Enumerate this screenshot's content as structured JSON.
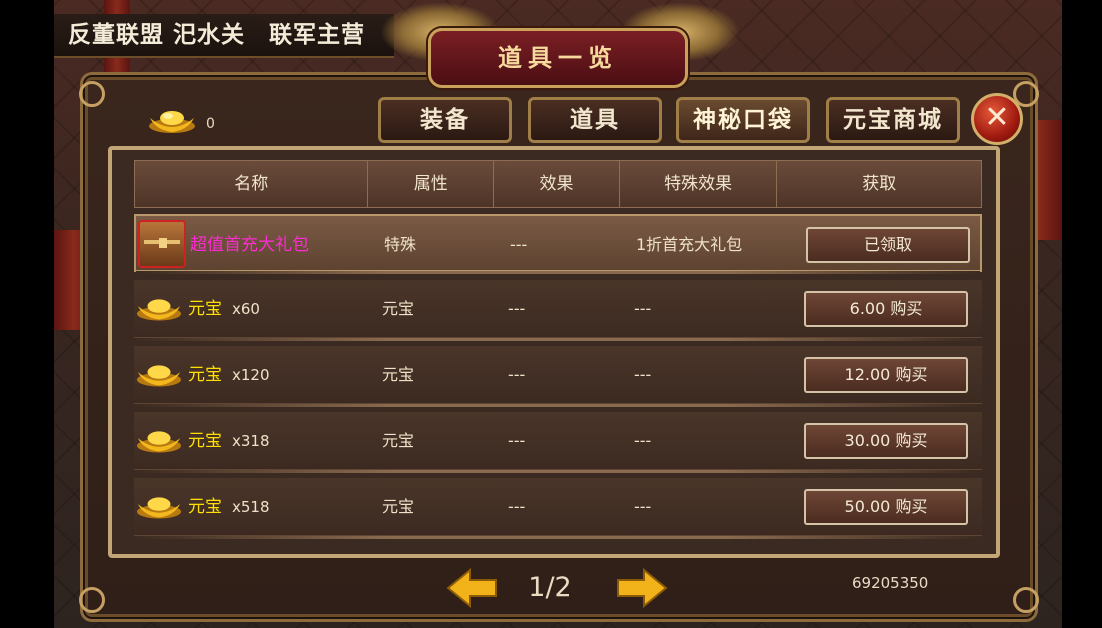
{
  "location": "反董联盟 汜水关　联军主营",
  "title": "道具一览",
  "currency": {
    "icon": "gold-ingot-icon",
    "value": "0"
  },
  "tabs": [
    {
      "label": "装备",
      "active": false
    },
    {
      "label": "道具",
      "active": false
    },
    {
      "label": "神秘口袋",
      "active": true
    },
    {
      "label": "元宝商城",
      "active": false
    }
  ],
  "close_label": "✕",
  "table": {
    "headers": [
      "名称",
      "属性",
      "效果",
      "特殊效果",
      "获取"
    ],
    "rows": [
      {
        "icon": "treasure-chest-icon",
        "name": "超值首充大礼包",
        "qty": "",
        "attr": "特殊",
        "effect": "---",
        "special": "1折首充大礼包",
        "action": "已领取"
      },
      {
        "icon": "gold-ingot-icon",
        "name": "元宝",
        "qty": "x60",
        "attr": "元宝",
        "effect": "---",
        "special": "---",
        "action": "6.00 购买"
      },
      {
        "icon": "gold-ingot-icon",
        "name": "元宝",
        "qty": "x120",
        "attr": "元宝",
        "effect": "---",
        "special": "---",
        "action": "12.00 购买"
      },
      {
        "icon": "gold-ingot-icon",
        "name": "元宝",
        "qty": "x318",
        "attr": "元宝",
        "effect": "---",
        "special": "---",
        "action": "30.00 购买"
      },
      {
        "icon": "gold-ingot-icon",
        "name": "元宝",
        "qty": "x518",
        "attr": "元宝",
        "effect": "---",
        "special": "---",
        "action": "50.00 购买"
      }
    ]
  },
  "pager": {
    "page": "1/2",
    "prev_icon": "arrow-left-icon",
    "next_icon": "arrow-right-icon"
  },
  "footer_id": "69205350",
  "colors": {
    "gold_text": "#ffe000",
    "special_text": "#ff2ad4",
    "frame": "#c3a676"
  }
}
